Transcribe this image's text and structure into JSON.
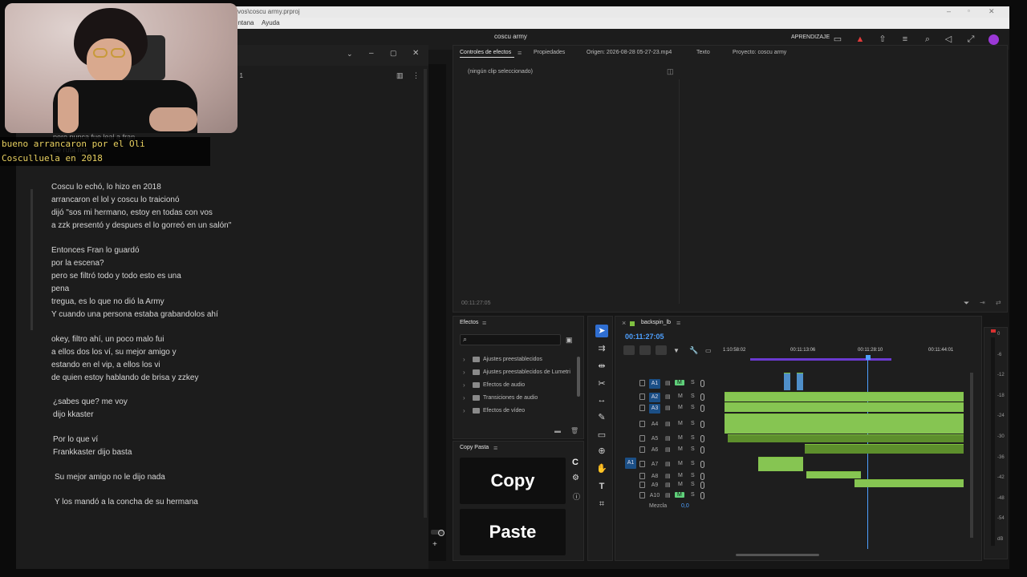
{
  "titlebar": {
    "path": "vos\\coscu army.prproj"
  },
  "menubar": {
    "items": [
      "entana",
      "Ayuda"
    ]
  },
  "header": {
    "project_title": "coscu army",
    "workspace": "APRENDIZAJE"
  },
  "effect_controls": {
    "tabs": [
      "Controles de efectos",
      "Propiedades",
      "Origen: 2026-08-28 05-27-23.mp4",
      "Texto",
      "Proyecto: coscu army"
    ],
    "empty_message": "(ningún clip seleccionado)",
    "timecode": "00:11:27:05"
  },
  "effects_panel": {
    "title": "Efectos",
    "items": [
      "Ajustes preestablecidos",
      "Ajustes preestablecidos de Lumetri",
      "Efectos de audio",
      "Transiciones de audio",
      "Efectos de vídeo"
    ]
  },
  "copy_pasta": {
    "title": "Copy Pasta",
    "copy_label": "Copy",
    "paste_label": "Paste",
    "side_icon_label": "C"
  },
  "timeline": {
    "sequence_name": "backspin_lb",
    "timecode": "00:11:27:05",
    "ruler": [
      "1:10:58:02",
      "00:11:13:06",
      "00:11:28:10",
      "00:11:44:01"
    ],
    "tracks": [
      {
        "name": "A1",
        "m": "M",
        "s": "S"
      },
      {
        "name": "A2",
        "m": "M",
        "s": "S"
      },
      {
        "name": "A3",
        "m": "M",
        "s": "S"
      },
      {
        "name": "A4",
        "m": "M",
        "s": "S"
      },
      {
        "name": "A5",
        "m": "M",
        "s": "S"
      },
      {
        "name": "A6",
        "m": "M",
        "s": "S"
      },
      {
        "name": "A7",
        "m": "M",
        "s": "S"
      },
      {
        "name": "A8",
        "m": "M",
        "s": "S"
      },
      {
        "name": "A9",
        "m": "M",
        "s": "S"
      },
      {
        "name": "A10",
        "m": "M",
        "s": "S"
      }
    ],
    "source_patch": "A1",
    "mix_label": "Mezcla",
    "mix_value": "0,0"
  },
  "meters": {
    "scale": [
      "0",
      "-6",
      "-12",
      "-18",
      "-24",
      "-30",
      "-36",
      "-42",
      "-48",
      "-54",
      "dB"
    ]
  },
  "document": {
    "tab_fragment": "lo 1",
    "lines": [
      "pero nunca fue leal a fran",
      "de ruta ma",
      "Coscu lo echó, lo hizo en 2018",
      "arrancaron el lol y coscu lo traicionó",
      "dijó \"sos mi hermano, estoy en todas con vos",
      "a zzk presentó y despues el lo gorreó en un salón\"",
      "Entonces Fran lo guardó",
      "por la escena?",
      "pero se filtró todo y todo esto es una",
      "pena",
      "tregua, es lo que no dió la Army",
      "Y cuando una persona estaba grabandolos ahí",
      "okey, filtro ahí, un poco malo fui",
      "a ellos dos los ví, su mejor amigo y",
      "estando en el vip, a ellos los vi",
      "de quien estoy hablando de brisa y zzkey",
      "¿sabes que? me voy",
      "dijo kkaster",
      "Por lo que ví",
      "Frankkaster dijo basta",
      "Su mejor amigo no le dijo nada",
      "Y los mandó a la concha de su hermana"
    ]
  },
  "caption": {
    "text": "bueno arrancaron por el Oli Cosculluela en 2018"
  }
}
